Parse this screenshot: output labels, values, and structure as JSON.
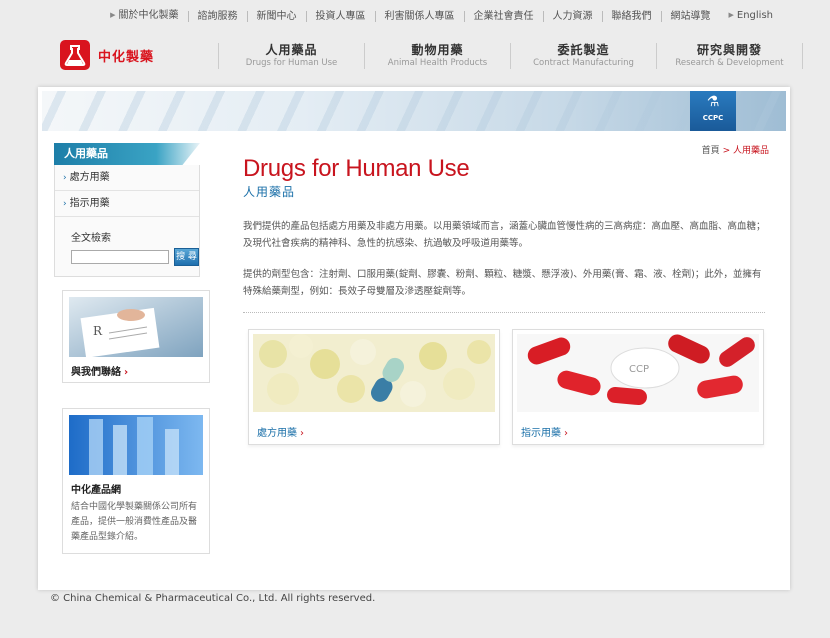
{
  "topnav": {
    "items": [
      "關於中化製藥",
      "諮詢服務",
      "新聞中心",
      "投資人專區",
      "利害關係人專區",
      "企業社會責任",
      "人力資源",
      "聯絡我們",
      "網站導覽",
      "English"
    ]
  },
  "brand": {
    "name": "中化製藥",
    "color": "#d9141e"
  },
  "mainnav": {
    "items": [
      {
        "zh": "人用藥品",
        "en": "Drugs for Human Use"
      },
      {
        "zh": "動物用藥",
        "en": "Animal Health Products"
      },
      {
        "zh": "委託製造",
        "en": "Contract Manufacturing"
      },
      {
        "zh": "研究與開發",
        "en": "Research & Development"
      }
    ]
  },
  "banner": {
    "badge": "CCPC"
  },
  "sidebar": {
    "title": "人用藥品",
    "links": [
      "處方用藥",
      "指示用藥"
    ],
    "search": {
      "label": "全文檢索",
      "button": "搜 尋",
      "value": ""
    }
  },
  "promos": [
    {
      "title": "與我們聯絡",
      "desc": ""
    },
    {
      "title": "中化產品網",
      "desc": "結合中國化學製藥關係公司所有產品，提供一般消費性產品及醫藥產品型錄介紹。"
    }
  ],
  "breadcrumb": {
    "home": "首頁",
    "sep": ">",
    "current": "人用藥品"
  },
  "content": {
    "title_en": "Drugs for Human Use",
    "title_zh": "人用藥品",
    "para1": "我們提供的產品包括處方用藥及非處方用藥。以用藥領域而言，涵蓋心臟血管慢性病的三高病症：高血壓、高血脂、高血糖；及現代社會疾病的精神科、急性的抗感染、抗過敏及呼吸道用藥等。",
    "para2": "提供的劑型包含：注射劑、口服用藥(錠劑、膠囊、粉劑、顆粒、糖漿、懸浮液)、外用藥(膏、霜、液、栓劑)；此外，並擁有特殊給藥劑型，例如：長效子母雙層及滲透壓錠劑等。"
  },
  "cards": [
    {
      "label": "處方用藥"
    },
    {
      "label": "指示用藥"
    }
  ],
  "footer": {
    "text": "© China Chemical & Pharmaceutical Co., Ltd. All rights reserved."
  }
}
